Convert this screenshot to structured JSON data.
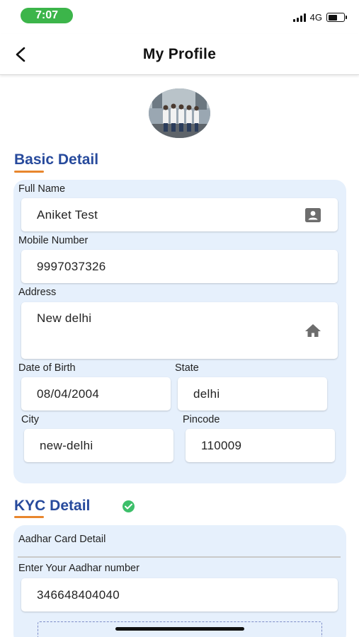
{
  "status_bar": {
    "time": "7:07",
    "network": "4G",
    "battery_level": 0.6
  },
  "header": {
    "title": "My Profile",
    "back_icon": "back-arrow-icon"
  },
  "avatar": {
    "icon": "profile-photo"
  },
  "basic_detail": {
    "heading": "Basic Detail",
    "full_name": {
      "label": "Full Name",
      "value": "Aniket Test",
      "icon": "contact-card-icon"
    },
    "mobile": {
      "label": "Mobile Number",
      "value": "9997037326"
    },
    "address": {
      "label": "Address",
      "value": "New delhi",
      "icon": "home-icon"
    },
    "dob": {
      "label": "Date of Birth",
      "value": "08/04/2004"
    },
    "state": {
      "label": "State",
      "value": "delhi"
    },
    "city": {
      "label": "City",
      "value": "new-delhi"
    },
    "pincode": {
      "label": "Pincode",
      "value": "110009"
    }
  },
  "kyc_detail": {
    "heading": "KYC Detail",
    "verified_icon": "check-circle-icon",
    "aadhar_section_label": "Aadhar Card Detail",
    "aadhar_input_label": "Enter Your Aadhar number",
    "aadhar_value": "346648404040"
  },
  "colors": {
    "heading_blue": "#274a9c",
    "accent_orange": "#e8862d",
    "card_bg": "#e6f0fc",
    "status_green": "#3cb54a",
    "verified_green": "#3dbf6a"
  }
}
